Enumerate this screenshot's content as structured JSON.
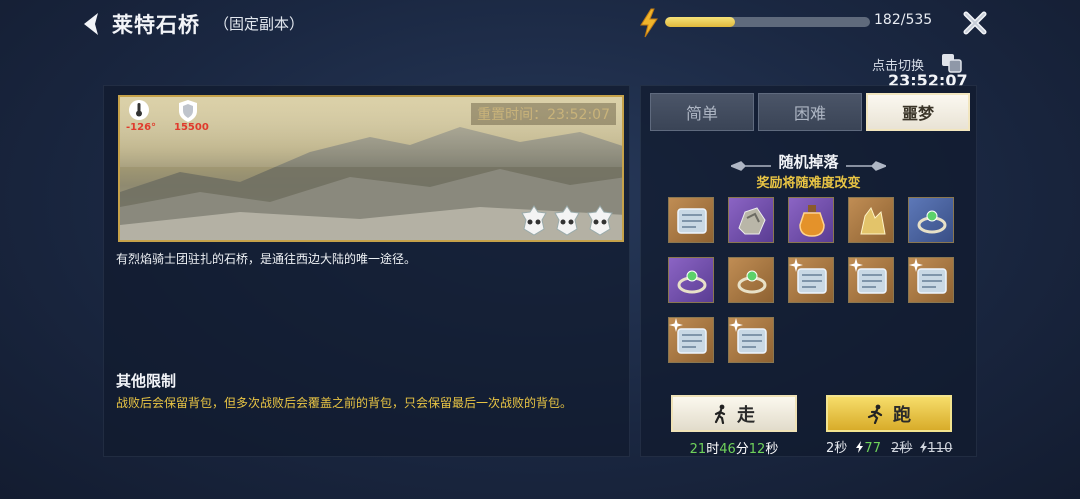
{
  "header": {
    "title": "莱特石桥",
    "subtitle": "（固定副本）",
    "energy_text": "182/535",
    "energy_progress": 0.34
  },
  "scene": {
    "reset_time": "重置时间：23:52:07",
    "temperature": "-126°",
    "defense": "15500",
    "difficulty_skulls": 3
  },
  "description": "有烈焰骑士团驻扎的石桥，是通往西边大陆的唯一途径。",
  "limits": {
    "title": "其他限制",
    "text": "战败后会保留背包，但多次战败后会覆盖之前的背包，只会保留最后一次战败的背包。"
  },
  "toggle": {
    "label": "点击切换",
    "time": "23:52:07"
  },
  "tabs": [
    {
      "label": "简单",
      "active": false
    },
    {
      "label": "困难",
      "active": false
    },
    {
      "label": "噩梦",
      "active": true
    }
  ],
  "drops": {
    "title": "随机掉落",
    "subtitle": "奖励将随难度改变",
    "items": [
      {
        "icon": "ice-scroll-icon",
        "rarity": "orange",
        "starred": false
      },
      {
        "icon": "crystal-ore-icon",
        "rarity": "purple",
        "starred": false
      },
      {
        "icon": "potion-bottle-icon",
        "rarity": "purple",
        "starred": false
      },
      {
        "icon": "gold-crystal-icon",
        "rarity": "orange",
        "starred": false
      },
      {
        "icon": "gem-ring-icon",
        "rarity": "blue",
        "starred": false
      },
      {
        "icon": "gem-ring-icon",
        "rarity": "purple",
        "starred": false
      },
      {
        "icon": "gem-ring-icon",
        "rarity": "orange",
        "starred": false
      },
      {
        "icon": "ice-scroll-icon",
        "rarity": "orange",
        "starred": true
      },
      {
        "icon": "ice-scroll-icon",
        "rarity": "orange",
        "starred": true
      },
      {
        "icon": "ice-scroll-icon",
        "rarity": "orange",
        "starred": true
      },
      {
        "icon": "ice-scroll-icon",
        "rarity": "orange",
        "starred": true
      },
      {
        "icon": "ice-scroll-icon",
        "rarity": "orange",
        "starred": true
      }
    ]
  },
  "actions": {
    "walk_label": "走",
    "walk_time": {
      "h": "21",
      "h_unit": "时",
      "m": "46",
      "m_unit": "分",
      "s": "12",
      "s_unit": "秒"
    },
    "run_label": "跑",
    "run_seconds": "2秒",
    "run_cost": "77",
    "run_old_seconds": "2秒",
    "run_old_cost": "110"
  },
  "colors": {
    "accent_gold": "#e9c544",
    "accent_green": "#6fd25b",
    "warning_red": "#e03a2c",
    "frame_gold": "#c6a24a"
  }
}
